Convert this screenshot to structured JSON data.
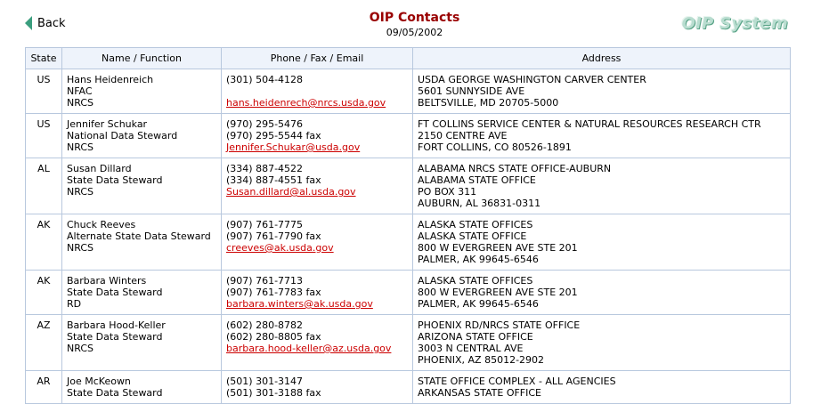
{
  "header": {
    "back_label": "Back",
    "title": "OIP Contacts",
    "date": "09/05/2002",
    "logo_text": "OIP System"
  },
  "table": {
    "columns": [
      "State",
      "Name / Function",
      "Phone / Fax / Email",
      "Address"
    ],
    "rows": [
      {
        "state": "US",
        "name": [
          "Hans Heidenreich",
          "NFAC",
          "NRCS"
        ],
        "phones": [
          "(301) 504-4128",
          ""
        ],
        "email": "hans.heidenrech@nrcs.usda.gov",
        "address": [
          "USDA GEORGE WASHINGTON CARVER CENTER",
          "5601 SUNNYSIDE AVE",
          "BELTSVILLE, MD 20705-5000"
        ]
      },
      {
        "state": "US",
        "name": [
          "Jennifer Schukar",
          "National Data Steward",
          "NRCS"
        ],
        "phones": [
          "(970) 295-5476",
          "(970) 295-5544 fax"
        ],
        "email": "Jennifer.Schukar@usda.gov",
        "address": [
          "FT COLLINS SERVICE CENTER & NATURAL RESOURCES RESEARCH CTR",
          "2150 CENTRE AVE",
          "FORT COLLINS, CO 80526-1891"
        ]
      },
      {
        "state": "AL",
        "name": [
          "Susan Dillard",
          "State Data Steward",
          "NRCS"
        ],
        "phones": [
          "(334) 887-4522",
          "(334) 887-4551 fax"
        ],
        "email": "Susan.dillard@al.usda.gov",
        "address": [
          "ALABAMA NRCS STATE OFFICE-AUBURN",
          "ALABAMA STATE OFFICE",
          "PO BOX 311",
          "AUBURN, AL 36831-0311"
        ]
      },
      {
        "state": "AK",
        "name": [
          "Chuck Reeves",
          "Alternate State Data Steward",
          "NRCS"
        ],
        "phones": [
          "(907) 761-7775",
          "(907) 761-7790 fax"
        ],
        "email": "creeves@ak.usda.gov",
        "address": [
          "ALASKA STATE OFFICES",
          "ALASKA STATE OFFICE",
          "800 W EVERGREEN AVE STE 201",
          "PALMER, AK 99645-6546"
        ]
      },
      {
        "state": "AK",
        "name": [
          "Barbara Winters",
          "State Data Steward",
          "RD"
        ],
        "phones": [
          "(907) 761-7713",
          "(907) 761-7783 fax"
        ],
        "email": "barbara.winters@ak.usda.gov",
        "address": [
          "ALASKA STATE OFFICES",
          "800 W EVERGREEN AVE STE 201",
          "PALMER, AK 99645-6546"
        ]
      },
      {
        "state": "AZ",
        "name": [
          "Barbara Hood-Keller",
          "State Data Steward",
          "NRCS"
        ],
        "phones": [
          "(602) 280-8782",
          "(602) 280-8805 fax"
        ],
        "email": "barbara.hood-keller@az.usda.gov",
        "address": [
          "PHOENIX RD/NRCS STATE OFFICE",
          "ARIZONA STATE OFFICE",
          "3003 N CENTRAL AVE",
          "PHOENIX, AZ 85012-2902"
        ]
      },
      {
        "state": "AR",
        "name": [
          "Joe McKeown",
          "State Data Steward",
          ""
        ],
        "phones": [
          "(501) 301-3147",
          "(501) 301-3188 fax"
        ],
        "email": "",
        "address": [
          "STATE OFFICE COMPLEX - ALL AGENCIES",
          "ARKANSAS STATE OFFICE"
        ]
      }
    ]
  }
}
